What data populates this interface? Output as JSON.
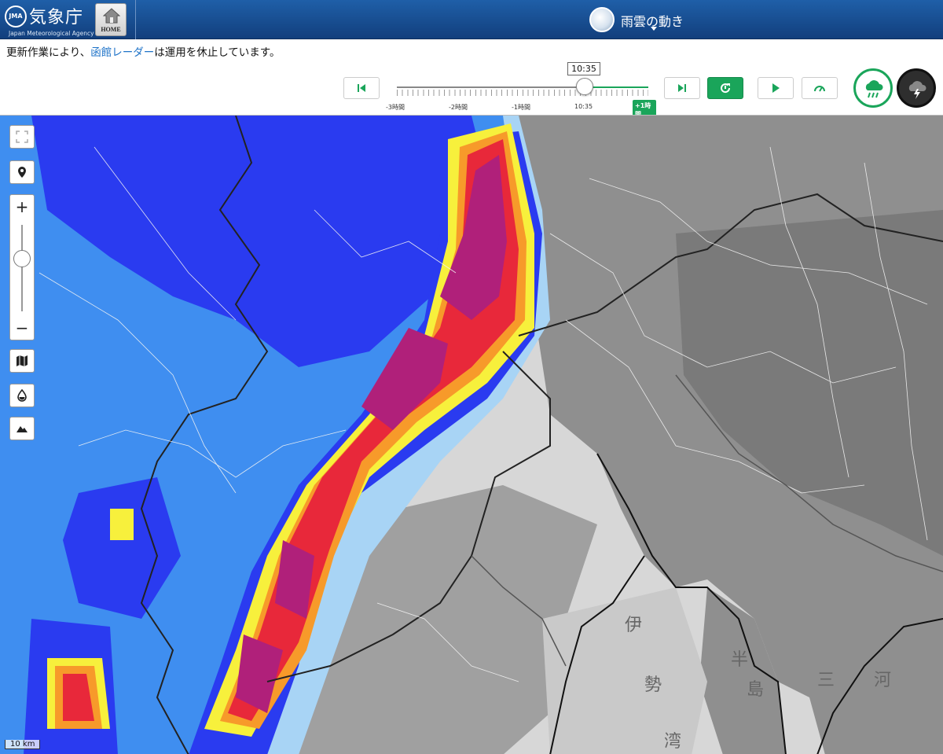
{
  "header": {
    "logo_mark": "JMA",
    "logo_jp": "気象庁",
    "logo_en": "Japan Meteorological Agency",
    "home_label": "HOME",
    "title": "雨雲の動き"
  },
  "notice": {
    "prefix": "更新作業により、",
    "link": "函館レーダー",
    "suffix": "は運用を休止しています。"
  },
  "timeline": {
    "current_time": "10:35",
    "labels": [
      "-3時間",
      "-2時間",
      "-1時間",
      "10:35"
    ],
    "future_badge": "+1時間",
    "position_fraction": 0.75
  },
  "controls": {
    "first_icon": "skip-first-icon",
    "last_icon": "skip-last-icon",
    "refresh_icon": "refresh-icon",
    "play_icon": "play-icon",
    "speed_icon": "speedometer-icon"
  },
  "modes": {
    "rain": "rain-cloud-icon",
    "cloud": "thunder-cloud-icon"
  },
  "map": {
    "labels": [
      "伊",
      "勢",
      "湾",
      "半",
      "島",
      "三",
      "河"
    ],
    "scale": "10 km",
    "zoom_in": "+",
    "zoom_out": "−",
    "colors": {
      "intense": "#b0207a",
      "heavy": "#e8283a",
      "strong": "#f79a2a",
      "moderate": "#f7f03c",
      "light": "#2a3bf0",
      "weak": "#3f8ef0",
      "faint": "#a8d4f5",
      "land": "#8c8c8c",
      "sea": "#d0d0d0"
    }
  }
}
